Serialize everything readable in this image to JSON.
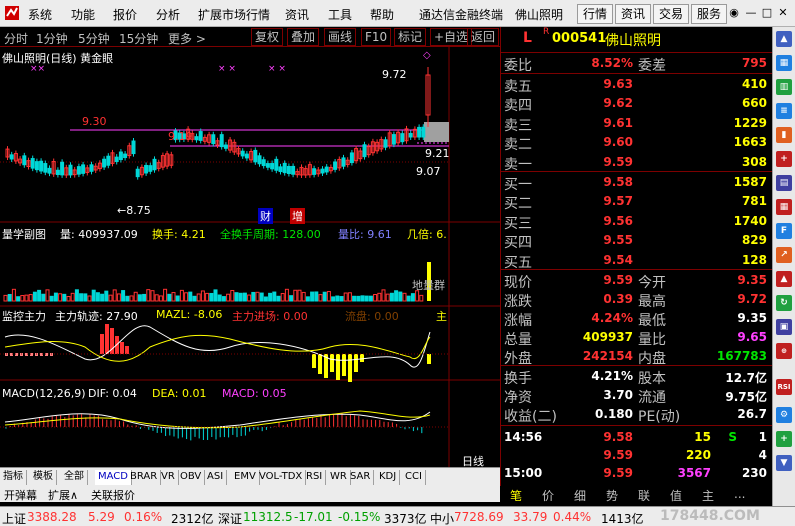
{
  "menubar": {
    "items": [
      "系统",
      "功能",
      "报价",
      "分析",
      "扩展市场行情",
      "资讯",
      "工具",
      "帮助"
    ],
    "title": "通达信金融终端",
    "stock": "佛山照明",
    "tabs": [
      "行情",
      "资讯",
      "交易",
      "服务"
    ]
  },
  "toolbar": {
    "periods": [
      "分时",
      "1分钟",
      "5分钟",
      "15分钟",
      "更多 >"
    ],
    "buttons": [
      "复权",
      "叠加",
      "画线",
      "F10",
      "标记",
      "+自选",
      "返回"
    ]
  },
  "chart": {
    "title": "佛山照明(日线) 黄金眼",
    "price_labels": {
      "p972": "9.72",
      "p930": "9.30",
      "p919": "9.19",
      "p921": "9.21",
      "p907": "9.07",
      "p875": "←8.75"
    },
    "badges": [
      "财",
      "增"
    ],
    "vol_header": {
      "name": "量学副图",
      "vol": "量: 409937.09",
      "hs": "换手: 4.21",
      "qhs": "全换手周期: 128.00",
      "lb": "量比: 9.61",
      "jb": "几倍: 6."
    },
    "vol_tag": "地量群",
    "jk_header": {
      "name": "监控主力",
      "gj": "主力轨迹: 27.90",
      "mazl": "MAZL: -8.06",
      "jc": "主力进场: 0.00",
      "lp": "流盘: 0.00",
      "end": "主"
    },
    "macd_header": {
      "name": "MACD(12,26,9)",
      "dif": "DIF: 0.04",
      "dea": "DEA: 0.01",
      "macd": "MACD: 0.05"
    },
    "period_tag": "日线"
  },
  "quote": {
    "flag": "L",
    "r": "R",
    "code": "000541",
    "name": "佛山照明",
    "wb_label": "委比",
    "wb_val": "8.52%",
    "wc_label": "委差",
    "wc_val": "795",
    "asks": [
      {
        "label": "卖五",
        "price": "9.63",
        "vol": "410"
      },
      {
        "label": "卖四",
        "price": "9.62",
        "vol": "660"
      },
      {
        "label": "卖三",
        "price": "9.61",
        "vol": "1229"
      },
      {
        "label": "卖二",
        "price": "9.60",
        "vol": "1663"
      },
      {
        "label": "卖一",
        "price": "9.59",
        "vol": "308"
      }
    ],
    "bids": [
      {
        "label": "买一",
        "price": "9.58",
        "vol": "1587"
      },
      {
        "label": "买二",
        "price": "9.57",
        "vol": "781"
      },
      {
        "label": "买三",
        "price": "9.56",
        "vol": "1740"
      },
      {
        "label": "买四",
        "price": "9.55",
        "vol": "829"
      },
      {
        "label": "买五",
        "price": "9.54",
        "vol": "128"
      }
    ],
    "stats": [
      {
        "l1": "现价",
        "v1": "9.59",
        "l2": "今开",
        "v2": "9.35"
      },
      {
        "l1": "涨跌",
        "v1": "0.39",
        "l2": "最高",
        "v2": "9.72"
      },
      {
        "l1": "涨幅",
        "v1": "4.24%",
        "l2": "最低",
        "v2": "9.35"
      },
      {
        "l1": "总量",
        "v1": "409937",
        "l2": "量比",
        "v2": "9.65"
      },
      {
        "l1": "外盘",
        "v1": "242154",
        "l2": "内盘",
        "v2": "167783"
      }
    ],
    "stats2": [
      {
        "l1": "换手",
        "v1": "4.21%",
        "l2": "股本",
        "v2": "12.7亿"
      },
      {
        "l1": "净资",
        "v1": "3.70",
        "l2": "流通",
        "v2": "9.75亿"
      },
      {
        "l1": "收益(二)",
        "v1": "0.180",
        "l2": "PE(动)",
        "v2": "26.7"
      }
    ],
    "ticks": [
      {
        "time": "14:56",
        "price": "9.58",
        "vol": "15",
        "flag": "S",
        "num": "1"
      },
      {
        "time": "",
        "price": "9.59",
        "vol": "220",
        "flag": "",
        "num": "4"
      },
      {
        "time": "15:00",
        "price": "9.59",
        "vol": "3567",
        "flag": "",
        "num": "230"
      }
    ],
    "tabs": [
      "笔",
      "价",
      "细",
      "势",
      "联",
      "值",
      "主",
      "..."
    ]
  },
  "bottom": {
    "tabs": [
      "指标",
      "模板",
      "全部",
      "MACD",
      "BRAR",
      "VR",
      "OBV",
      "ASI",
      "EMV",
      "VOL-TDX",
      "RSI",
      "WR",
      "SAR",
      "KDJ",
      "CCI"
    ],
    "subtabs": [
      "开弹幕",
      "扩展∧",
      "关联报价"
    ]
  },
  "status": {
    "sh_label": "上证",
    "sh_val": "3388.28",
    "sh_chg": "5.29",
    "sh_pct": "0.16%",
    "sh_amt": "2312亿",
    "sz_label": "深证",
    "sz_val": "11312.5",
    "sz_chg": "-17.01",
    "sz_pct": "-0.15%",
    "sz_amt": "3373亿",
    "zx_label": "中小",
    "zx_val": "7728.69",
    "zx_chg": "33.79",
    "zx_pct": "0.44%",
    "zx_amt": "1413亿",
    "watermark": "178448.COM"
  },
  "colors": {
    "up": "#ff3232",
    "down": "#00e600",
    "bg": "#000000",
    "grid": "#7d0000"
  }
}
